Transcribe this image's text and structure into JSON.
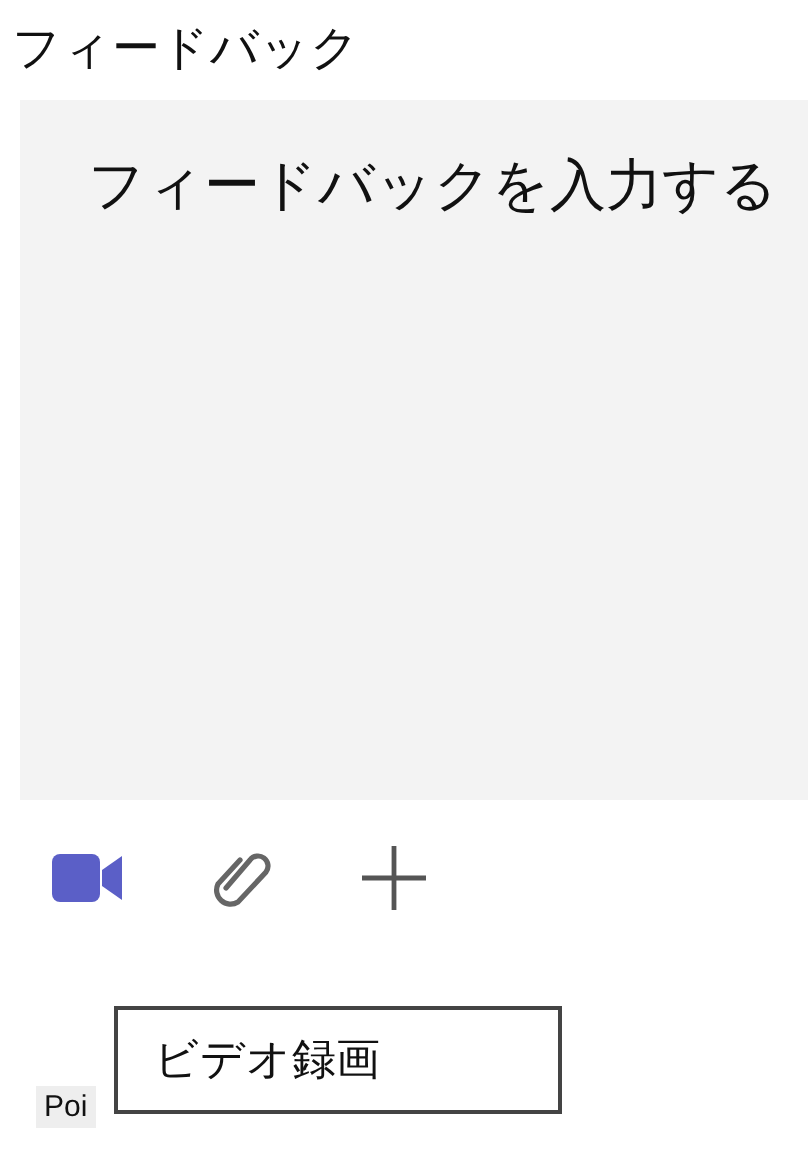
{
  "title": "フィードバック",
  "feedback_field": {
    "placeholder": "フィードバックを入力する"
  },
  "toolbar": [
    {
      "kind": "video"
    },
    {
      "kind": "attach"
    },
    {
      "kind": "add"
    }
  ],
  "tooltip": "ビデオ録画",
  "label_fragment": "Poi"
}
